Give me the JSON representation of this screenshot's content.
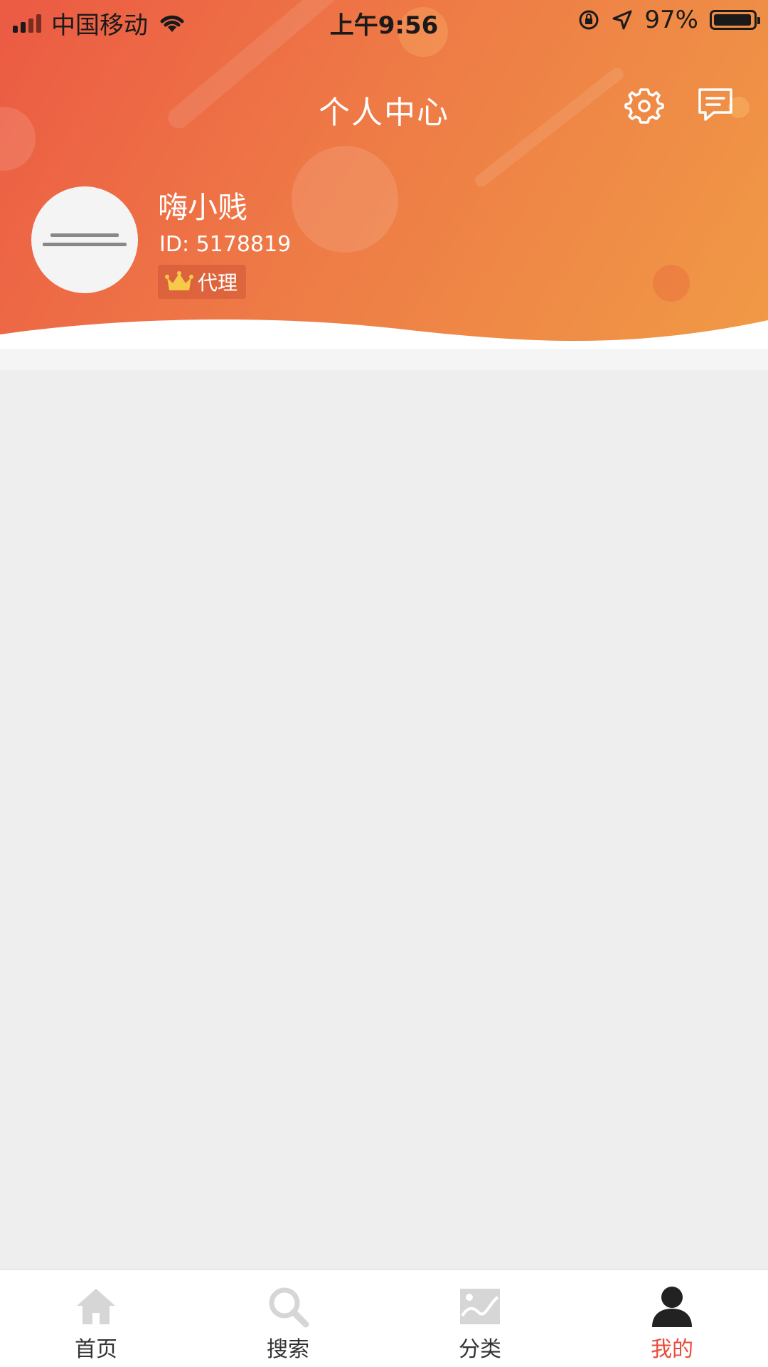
{
  "status_bar": {
    "carrier": "中国移动",
    "time": "上午9:56",
    "battery": "97%",
    "battery_level": 0.97
  },
  "header": {
    "title": "个人中心",
    "settings_icon": "gear-icon",
    "messages_icon": "message-icon"
  },
  "profile": {
    "name": "嗨小贱",
    "id_text": "ID: 5178819",
    "badge_label": "代理",
    "badge_icon": "crown-icon"
  },
  "tabs": [
    {
      "label": "首页",
      "icon": "home-icon",
      "active": false
    },
    {
      "label": "搜索",
      "icon": "search-icon",
      "active": false
    },
    {
      "label": "分类",
      "icon": "image-icon",
      "active": false
    },
    {
      "label": "我的",
      "icon": "user-icon",
      "active": true
    }
  ],
  "colors": {
    "header_start": "#ec5a44",
    "header_end": "#f09a46",
    "accent": "#e94b3c",
    "tab_inactive_icon": "#d6d6d6",
    "tab_active_icon": "#222222"
  }
}
